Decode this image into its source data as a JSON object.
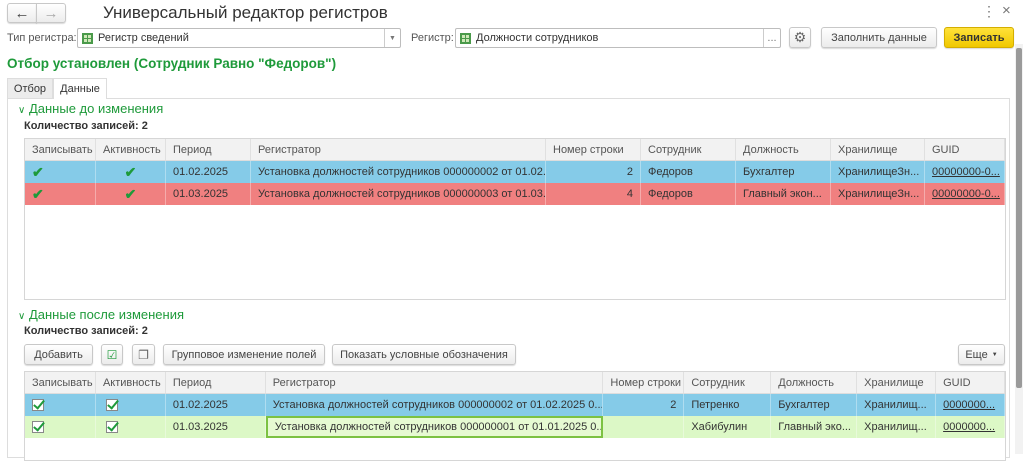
{
  "header": {
    "title": "Универсальный редактор регистров",
    "back": "←",
    "forward": "→",
    "more": "⋮",
    "close": "×"
  },
  "toolbar": {
    "type_label": "Тип регистра:",
    "type_value": "Регистр сведений",
    "register_label": "Регистр:",
    "register_value": "Должности сотрудников",
    "ellipsis": "...",
    "fill_button": "Заполнить данные",
    "save_button": "Записать"
  },
  "filter_text": "Отбор установлен (Сотрудник Равно \"Федоров\")",
  "tabs": [
    "Отбор",
    "Данные"
  ],
  "before": {
    "title": "Данные до изменения",
    "count": "Количество записей: 2",
    "columns": [
      "Записывать",
      "Активность",
      "Период",
      "Регистратор",
      "Номер строки",
      "Сотрудник",
      "Должность",
      "Хранилище",
      "GUID"
    ],
    "rows": [
      {
        "period": "01.02.2025",
        "registrator": "Установка должностей сотрудников 000000002 от 01.02.2...",
        "line": "2",
        "employee": "Федоров",
        "position": "Бухгалтер",
        "storage": "ХранилищеЗн...",
        "guid": "00000000-0..."
      },
      {
        "period": "01.03.2025",
        "registrator": "Установка должностей сотрудников 000000003 от 01.03.2...",
        "line": "4",
        "employee": "Федоров",
        "position": "Главный экон...",
        "storage": "ХранилищеЗн...",
        "guid": "00000000-0..."
      }
    ]
  },
  "after": {
    "title": "Данные после изменения",
    "count": "Количество записей: 2",
    "add_button": "Добавить",
    "group_button": "Групповое изменение полей",
    "legend_button": "Показать условные обозначения",
    "more_button": "Еще",
    "columns": [
      "Записывать",
      "Активность",
      "Период",
      "Регистратор",
      "Номер строки",
      "Сотрудник",
      "Должность",
      "Хранилище",
      "GUID"
    ],
    "rows": [
      {
        "period": "01.02.2025",
        "registrator": "Установка должностей сотрудников 000000002 от 01.02.2025 0...",
        "line": "2",
        "employee": "Петренко",
        "position": "Бухгалтер",
        "storage": "Хранилищ...",
        "guid": "0000000..."
      },
      {
        "period": "01.03.2025",
        "registrator": "Установка должностей сотрудников 000000001 от 01.01.2025 0...",
        "line": "",
        "employee": "Хабибулин",
        "position": "Главный эко...",
        "storage": "Хранилищ...",
        "guid": "0000000..."
      }
    ]
  },
  "colors": {
    "blue_row": "#85cbe8",
    "red_row": "#f08080",
    "green_row": "#dcf8c6",
    "accent": "#1e9a3a",
    "save": "#f5d000"
  }
}
